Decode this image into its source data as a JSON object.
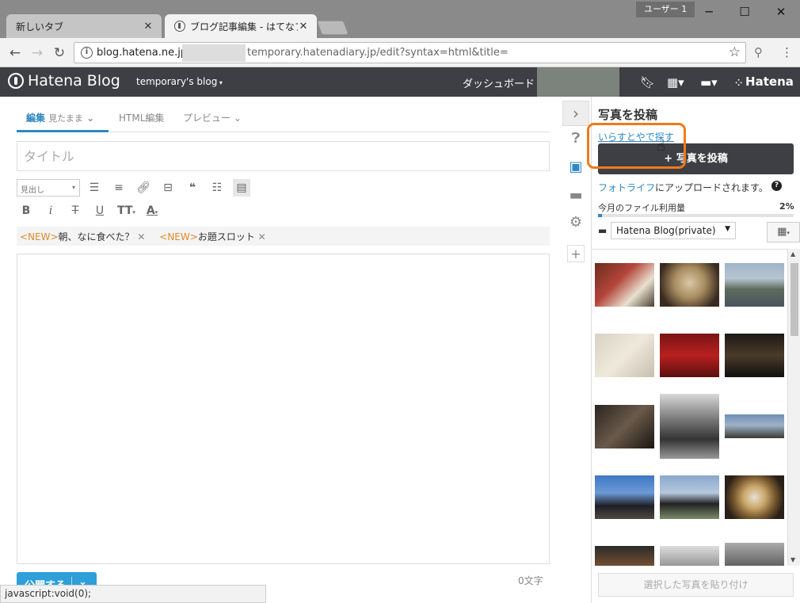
{
  "browser": {
    "tabs": [
      {
        "label": "新しいタブ"
      },
      {
        "label": "ブログ記事編集 - はてなブロ"
      }
    ],
    "user_badge": "ユーザー 1",
    "address": {
      "host": "blog.hatena.ne.jp",
      "path": "temporary.hatenadiary.jp/edit?syntax=html&title="
    },
    "status": "javascript:void(0);"
  },
  "header": {
    "logo": "Hatena Blog",
    "blog_selector": "temporary's blog",
    "dashboard": "ダッシュボード",
    "brand": "Hatena"
  },
  "editor": {
    "tabs": [
      {
        "label": "編集",
        "sub": "見たまま"
      },
      {
        "label": "HTML編集"
      },
      {
        "label": "プレビュー"
      }
    ],
    "title_placeholder": "タイトル",
    "heading_select": "見出し",
    "tags": [
      {
        "new": "<NEW>",
        "label": "朝、なに食べた？"
      },
      {
        "new": "<NEW>",
        "label": "お題スロット"
      }
    ],
    "char_count": "0文字",
    "publish": "公開する"
  },
  "panel": {
    "title": "写真を投稿",
    "irasutoya": "いらすとやで探す",
    "post_button": "写真を投稿",
    "fotolife_link": "フォトライフ",
    "fotolife_rest": "にアップロードされます。",
    "usage_label": "今月のファイル利用量",
    "usage_value": "2%",
    "usage_fraction": 0.02,
    "album": "Hatena Blog(private)",
    "paste_button": "選択した写真を貼り付け"
  },
  "colors": {
    "accent": "#2f87c4",
    "highlight": "#f07a1a",
    "header_bg": "#3d3f44"
  }
}
